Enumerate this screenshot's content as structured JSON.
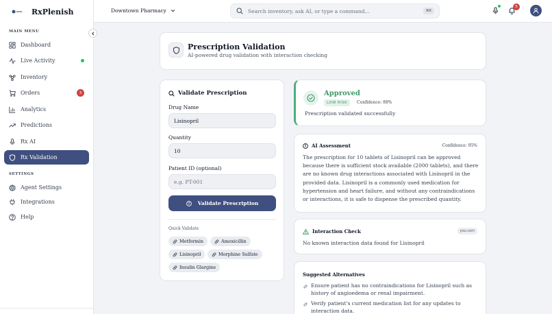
{
  "brand": {
    "name": "RxPlenish"
  },
  "sidebar": {
    "main_menu_title": "MAIN MENU",
    "items": [
      {
        "label": "Dashboard",
        "icon": "dashboard-icon"
      },
      {
        "label": "Live Activity",
        "icon": "activity-icon"
      },
      {
        "label": "Inventory",
        "icon": "inventory-icon"
      },
      {
        "label": "Orders",
        "icon": "cart-icon",
        "badge": "3"
      },
      {
        "label": "Analytics",
        "icon": "analytics-icon"
      },
      {
        "label": "Predictions",
        "icon": "trending-icon"
      },
      {
        "label": "Rx AI",
        "icon": "mic-icon"
      },
      {
        "label": "Rx Validation",
        "icon": "shield-icon",
        "active": true
      }
    ],
    "settings_title": "SETTINGS",
    "settings_items": [
      {
        "label": "Agent Settings",
        "icon": "gear-icon"
      },
      {
        "label": "Integrations",
        "icon": "plug-icon"
      },
      {
        "label": "Help",
        "icon": "help-icon"
      }
    ]
  },
  "topbar": {
    "store": "Downtown Pharmacy",
    "search_placeholder": "Search inventory, ask AI, or type a command...",
    "shortcut": "⌘K",
    "notifications_count": "5"
  },
  "header": {
    "title": "Prescription Validation",
    "subtitle": "AI-powered drug validation with interaction checking"
  },
  "form": {
    "title": "Validate Prescription",
    "drug_label": "Drug Name",
    "drug_value": "Lisinopril",
    "quantity_label": "Quantity",
    "quantity_value": "10",
    "patient_label": "Patient ID (optional)",
    "patient_placeholder": "e.g. PT-001",
    "submit_label": "Validate Prescription",
    "quick_label": "Quick Validate",
    "quick_items": [
      "Metformin",
      "Amoxicillin",
      "Lisinopril",
      "Morphine Sulfate",
      "Insulin Glargine"
    ]
  },
  "result": {
    "status": "Approved",
    "risk": "LOW RISK",
    "confidence": "Confidence: 88%",
    "message": "Prescription validated successfully"
  },
  "ai_assessment": {
    "title": "AI Assessment",
    "confidence": "Confidence: 95%",
    "text": "The prescription for 10 tablets of Lisinopril can be approved because there is sufficient stock available (2000 tablets), and there are no known drug interactions associated with Lisinopril in the provided data. Lisinopril is a commonly used medication for hypertension and heart failure, and without any contraindications or interactions, it is safe to dispense the prescribed quantity."
  },
  "interaction": {
    "title": "Interaction Check",
    "tag": "you.com",
    "message": "No known interaction data found for Lisinopril"
  },
  "alternatives": {
    "title": "Suggested Alternatives",
    "items": [
      "Ensure patient has no contraindications for Lisinopril such as history of angioedema or renal impairment.",
      "Verify patient's current medication list for any updates to interaction data."
    ]
  },
  "colors": {
    "accent": "#3f4f7f",
    "success": "#3e9a68",
    "danger": "#d14343"
  }
}
